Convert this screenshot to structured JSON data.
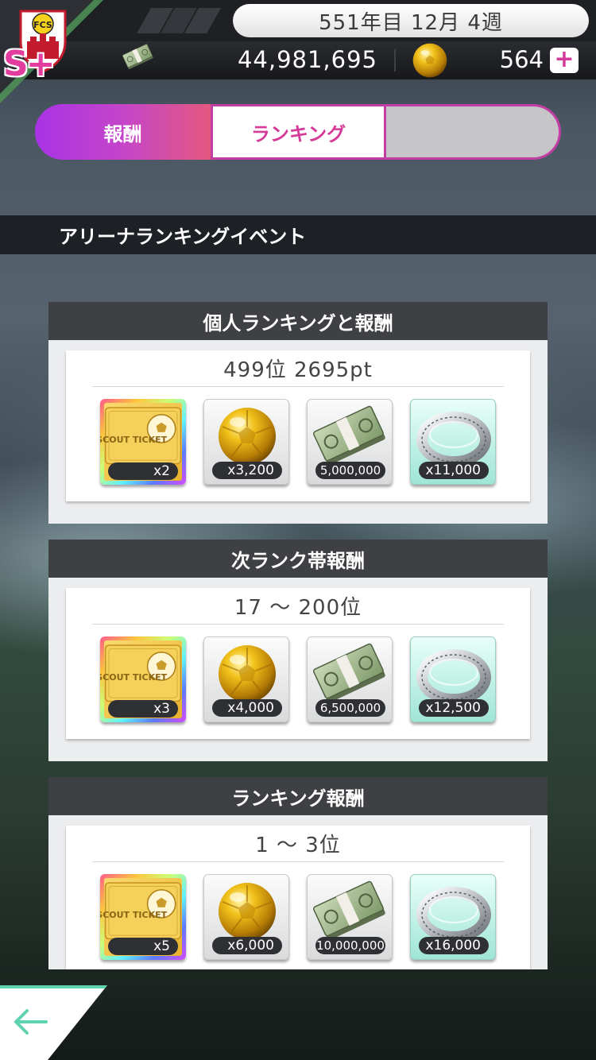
{
  "header": {
    "date": "551年目 12月 4週",
    "money": "44,981,695",
    "coins": "564",
    "plus_label": "+",
    "rank_badge": "S+"
  },
  "tabs": [
    {
      "label": "報酬"
    },
    {
      "label": "ランキング"
    },
    {
      "label": ""
    }
  ],
  "event": {
    "title": "アリーナランキングイベント"
  },
  "panels": [
    {
      "header": "個人ランキングと報酬",
      "subtitle": "499位 2695pt",
      "items": [
        {
          "kind": "scout-ticket",
          "qty": "x2"
        },
        {
          "kind": "gold-ball",
          "qty": "x3,200"
        },
        {
          "kind": "money",
          "qty": "5,000,000"
        },
        {
          "kind": "silver-ring",
          "qty": "x11,000"
        }
      ]
    },
    {
      "header": "次ランク帯報酬",
      "subtitle": "17 ～ 200位",
      "items": [
        {
          "kind": "scout-ticket",
          "qty": "x3"
        },
        {
          "kind": "gold-ball",
          "qty": "x4,000"
        },
        {
          "kind": "money",
          "qty": "6,500,000"
        },
        {
          "kind": "silver-ring",
          "qty": "x12,500"
        }
      ]
    },
    {
      "header": "ランキング報酬",
      "subtitle": "1 ～ 3位",
      "items": [
        {
          "kind": "scout-ticket",
          "qty": "x5"
        },
        {
          "kind": "gold-ball",
          "qty": "x6,000"
        },
        {
          "kind": "money",
          "qty": "10,000,000"
        },
        {
          "kind": "silver-ring",
          "qty": "x16,000"
        }
      ]
    }
  ],
  "ticket_text": "SCOUT TICKET",
  "logo_text": "FCS",
  "icons": {
    "back": "back-arrow-icon",
    "money": "money-stack-icon",
    "coin": "gold-coin-icon"
  },
  "colors": {
    "accent_pink": "#d53a98",
    "tab_gradient_start": "#a933e6",
    "tab_gradient_end": "#e4587f",
    "back_arrow": "#5fd3b0"
  }
}
